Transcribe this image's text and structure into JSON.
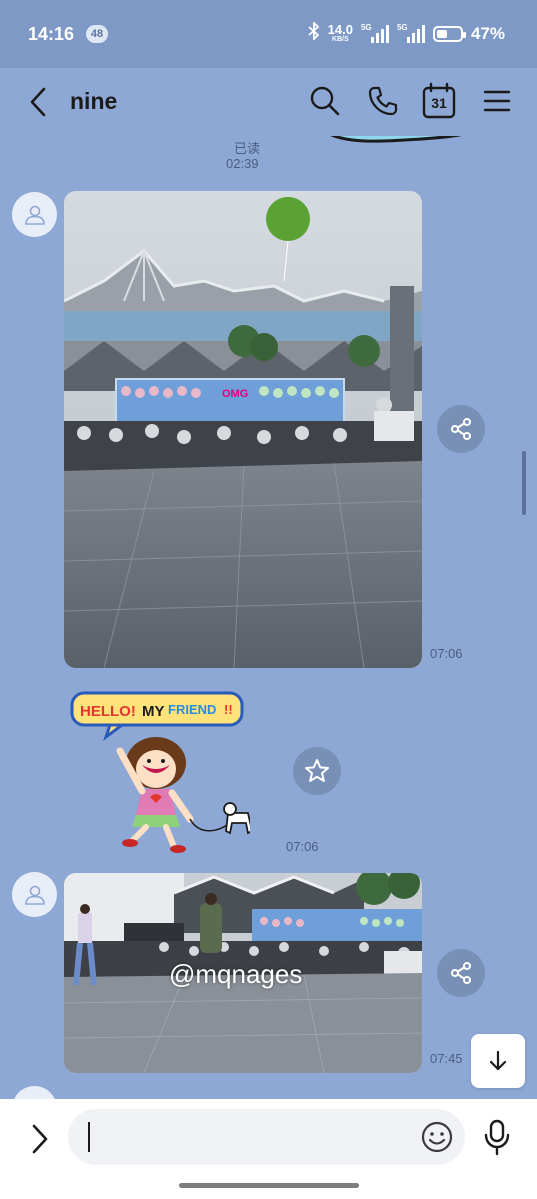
{
  "status_bar": {
    "time": "14:16",
    "notification_count": "48",
    "network_speed_value": "14.0",
    "network_speed_unit": "KB/S",
    "signal1_label": "5G",
    "signal2_label": "5G",
    "battery_percent": "47%",
    "battery_level": 0.47
  },
  "header": {
    "title": "nine",
    "calendar_day": "31"
  },
  "messages": {
    "read_label": "已读",
    "read_time": "02:39",
    "photo1_time": "07:06",
    "sticker_text_1": "HELLO!",
    "sticker_text_2": "MY",
    "sticker_text_3": "FRIEND",
    "sticker_text_4": "!!",
    "sticker_time": "07:06",
    "photo2_time": "07:45",
    "photo2_watermark": "@mqnages",
    "banner_text": "OMG"
  },
  "input": {
    "placeholder": ""
  },
  "colors": {
    "chat_background": "#8ea8d6",
    "status_bar": "#7f99c6",
    "input_bar": "#ffffff"
  },
  "icons": [
    "back-icon",
    "search-icon",
    "phone-icon",
    "calendar-icon",
    "menu-icon",
    "share-icon",
    "star-icon",
    "arrow-down-icon",
    "chevron-right-icon",
    "emoji-icon",
    "mic-icon",
    "user-icon"
  ]
}
